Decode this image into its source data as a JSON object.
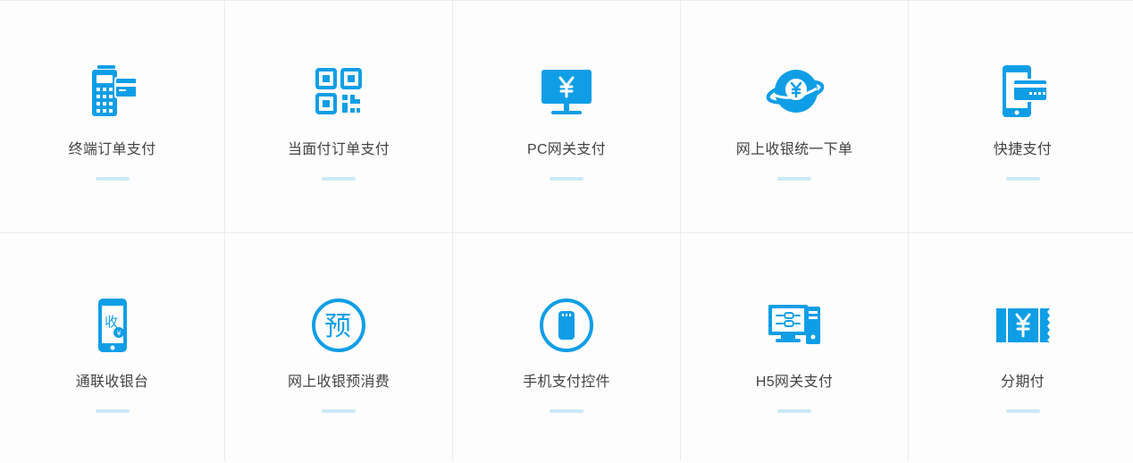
{
  "accent": "#0f9ee6",
  "products": [
    {
      "label": "终端订单支付",
      "icon": "pos-terminal-icon"
    },
    {
      "label": "当面付订单支付",
      "icon": "qr-code-icon"
    },
    {
      "label": "PC网关支付",
      "icon": "monitor-yen-icon"
    },
    {
      "label": "网上收银统一下单",
      "icon": "globe-yen-icon"
    },
    {
      "label": "快捷支付",
      "icon": "phone-card-icon"
    },
    {
      "label": "通联收银台",
      "icon": "phone-receive-icon"
    },
    {
      "label": "网上收银预消费",
      "icon": "prepay-circle-icon"
    },
    {
      "label": "手机支付控件",
      "icon": "phone-circle-icon"
    },
    {
      "label": "H5网关支付",
      "icon": "h5-computer-icon"
    },
    {
      "label": "分期付",
      "icon": "installment-ticket-icon"
    }
  ]
}
